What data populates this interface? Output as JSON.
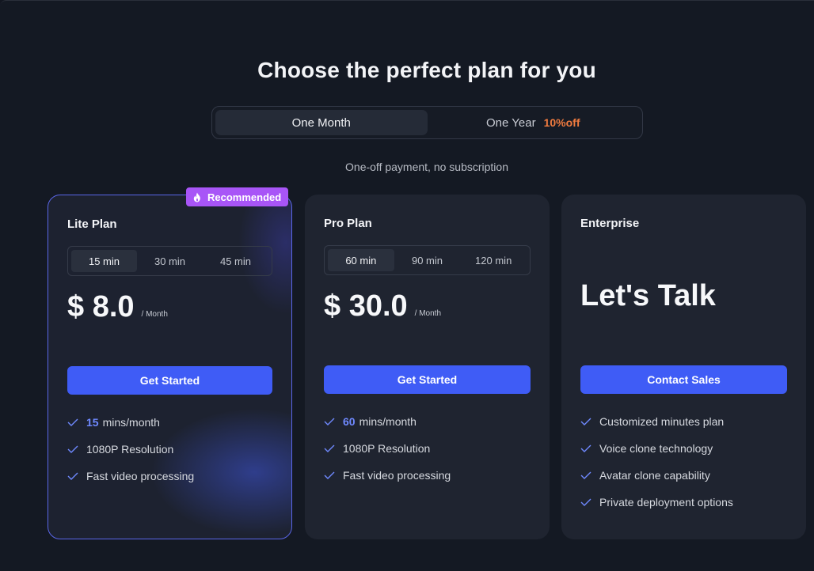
{
  "title": "Choose the perfect plan for you",
  "billing": {
    "month_label": "One Month",
    "year_label": "One Year",
    "year_discount": "10%off"
  },
  "subtitle": "One-off payment, no subscription",
  "badge": {
    "label": "Recommended",
    "icon": "flame-icon",
    "color": "#a855f7"
  },
  "accent_color": "#3f5cf6",
  "plans": [
    {
      "name": "Lite Plan",
      "durations": [
        "15 min",
        "30 min",
        "45 min"
      ],
      "selected_duration": "15 min",
      "price": "$ 8.0",
      "period": "/ Month",
      "cta": "Get Started",
      "features": [
        {
          "highlight": "15",
          "text": "mins/month"
        },
        {
          "highlight": "",
          "text": "1080P Resolution"
        },
        {
          "highlight": "",
          "text": "Fast video processing"
        }
      ]
    },
    {
      "name": "Pro Plan",
      "durations": [
        "60 min",
        "90 min",
        "120 min"
      ],
      "selected_duration": "60 min",
      "price": "$ 30.0",
      "period": "/ Month",
      "cta": "Get Started",
      "features": [
        {
          "highlight": "60",
          "text": "mins/month"
        },
        {
          "highlight": "",
          "text": "1080P Resolution"
        },
        {
          "highlight": "",
          "text": "Fast video processing"
        }
      ]
    },
    {
      "name": "Enterprise",
      "headline": "Let's Talk",
      "cta": "Contact Sales",
      "features": [
        {
          "highlight": "",
          "text": "Customized minutes plan"
        },
        {
          "highlight": "",
          "text": "Voice clone technology"
        },
        {
          "highlight": "",
          "text": "Avatar clone capability"
        },
        {
          "highlight": "",
          "text": "Private deployment options"
        }
      ]
    }
  ]
}
